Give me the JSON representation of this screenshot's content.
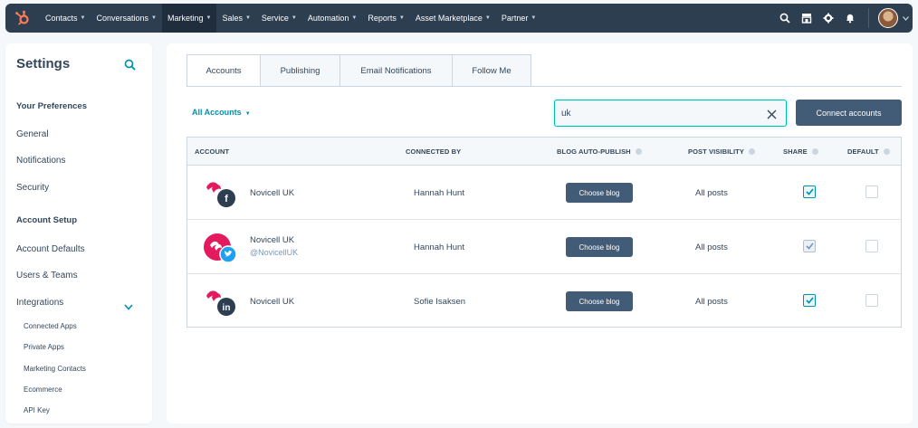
{
  "nav": {
    "items": [
      {
        "label": "Contacts",
        "active": false
      },
      {
        "label": "Conversations",
        "active": false
      },
      {
        "label": "Marketing",
        "active": true
      },
      {
        "label": "Sales",
        "active": false
      },
      {
        "label": "Service",
        "active": false
      },
      {
        "label": "Automation",
        "active": false
      },
      {
        "label": "Reports",
        "active": false
      },
      {
        "label": "Asset Marketplace",
        "active": false
      },
      {
        "label": "Partner",
        "active": false
      }
    ],
    "icons": [
      "search-icon",
      "marketplace-icon",
      "gear-icon",
      "bell-icon"
    ],
    "brand_color": "#ff7a59"
  },
  "sidebar": {
    "title": "Settings",
    "section_preferences": "Your Preferences",
    "general": "General",
    "notifications": "Notifications",
    "security": "Security",
    "section_account_setup": "Account Setup",
    "account_defaults": "Account Defaults",
    "users_teams": "Users & Teams",
    "integrations": "Integrations",
    "sub": [
      "Connected Apps",
      "Private Apps",
      "Marketing Contacts",
      "Ecommerce",
      "API Key"
    ]
  },
  "tabs": [
    {
      "label": "Accounts",
      "active": true
    },
    {
      "label": "Publishing",
      "active": false
    },
    {
      "label": "Email Notifications",
      "active": false
    },
    {
      "label": "Follow Me",
      "active": false
    }
  ],
  "filter": {
    "label": "All Accounts"
  },
  "search": {
    "value": "uk"
  },
  "connect_button": "Connect accounts",
  "table": {
    "headers": {
      "account": "ACCOUNT",
      "connected_by": "CONNECTED BY",
      "blog_auto_publish": "BLOG AUTO-PUBLISH",
      "post_visibility": "POST VISIBILITY",
      "share": "SHARE",
      "default": "DEFAULT"
    },
    "rows": [
      {
        "name": "Novicell UK",
        "handle": "",
        "network": "facebook-icon",
        "network_color": "#3b5998",
        "connected_by": "Hannah Hunt",
        "blog_button": "Choose blog",
        "visibility": "All posts",
        "share": true,
        "share_disabled": false,
        "default": false
      },
      {
        "name": "Novicell UK",
        "handle": "@NovicellUK",
        "network": "twitter-icon",
        "network_color": "#1da1f2",
        "connected_by": "Hannah Hunt",
        "blog_button": "Choose blog",
        "visibility": "All posts",
        "share": true,
        "share_disabled": true,
        "default": false
      },
      {
        "name": "Novicell UK",
        "handle": "",
        "network": "linkedin-icon",
        "network_color": "#0a66c2",
        "connected_by": "Sofie Isaksen",
        "blog_button": "Choose blog",
        "visibility": "All posts",
        "share": true,
        "share_disabled": false,
        "default": false
      }
    ]
  }
}
